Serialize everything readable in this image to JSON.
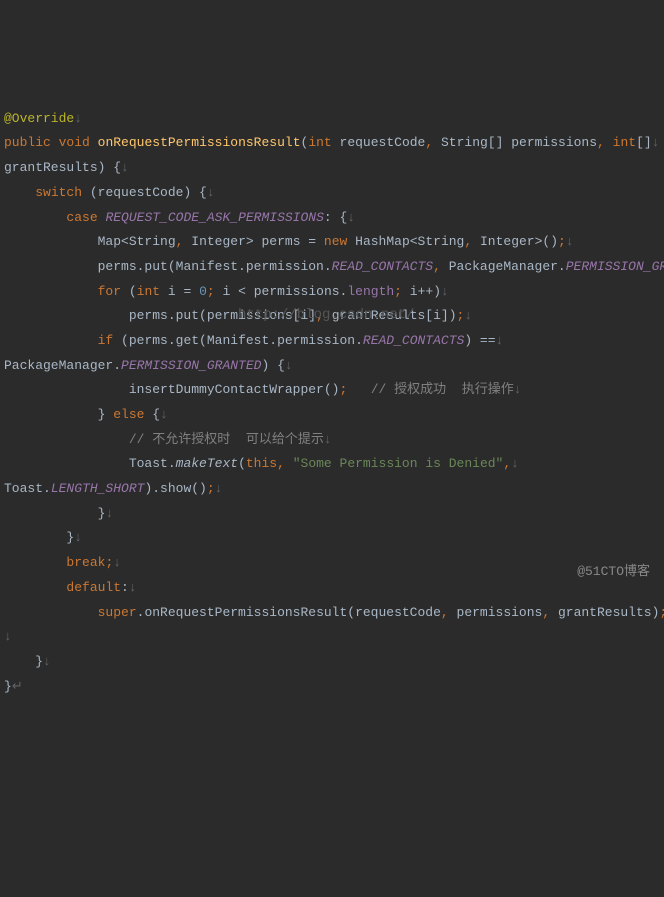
{
  "code": {
    "annotation": "@Override",
    "kw_public": "public",
    "kw_void": "void",
    "method_name": "onRequestPermissionsResult",
    "kw_int": "int",
    "param_requestCode": "requestCode",
    "type_StringArr": "String[]",
    "param_permissions": "permissions",
    "param_grantResults": "grantResults",
    "kw_switch": "switch",
    "kw_case": "case",
    "const_REQUEST_CODE": "REQUEST_CODE_ASK_PERMISSIONS",
    "type_Map": "Map<String",
    "type_Integer": "Integer>",
    "var_perms": "perms",
    "kw_new": "new",
    "type_HashMap": "HashMap<String",
    "call_permsput": "perms.put(Manifest.permission.",
    "const_READ_CONTACTS": "READ_CONTACTS",
    "pkg_PackageManager": "PackageManager.",
    "const_PERMISSION_GRANTED": "PERMISSION_GRANTED",
    "kw_for": "for",
    "num_0": "0",
    "var_i": "i",
    "call_permissions_length": "i < permissions.",
    "field_length": "length",
    "inc": "i++)",
    "call_permsput2": "perms.put(permissions[i]",
    "call_grantResults": "grantResults[i])",
    "kw_if": "if",
    "call_permsget": "(perms.get(Manifest.permission.",
    "pkg_PackageManager2": "PackageManager.",
    "call_insertDummy": "insertDummyContactWrapper()",
    "comment_success": "// 授权成功  执行操作",
    "kw_else": "else",
    "comment_deny": "// 不允许授权时  可以给个提示",
    "cls_Toast": "Toast.",
    "method_makeText": "makeText",
    "kw_this": "this",
    "str_denied": "\"Some Permission is Denied\"",
    "cls_Toast2": "Toast.",
    "const_LENGTH_SHORT": "LENGTH_SHORT",
    "call_show": ").show()",
    "kw_break": "break",
    "kw_default": "default",
    "kw_super": "super",
    "call_super": ".onRequestPermissionsResult(requestCode",
    "arg_permissions": "permissions",
    "arg_grantResults": "grantResults)"
  },
  "watermark1": "http://blog.csdn.net/",
  "watermark2": "@51CTO博客",
  "arrow": "↓",
  "arrow_end": "↵"
}
